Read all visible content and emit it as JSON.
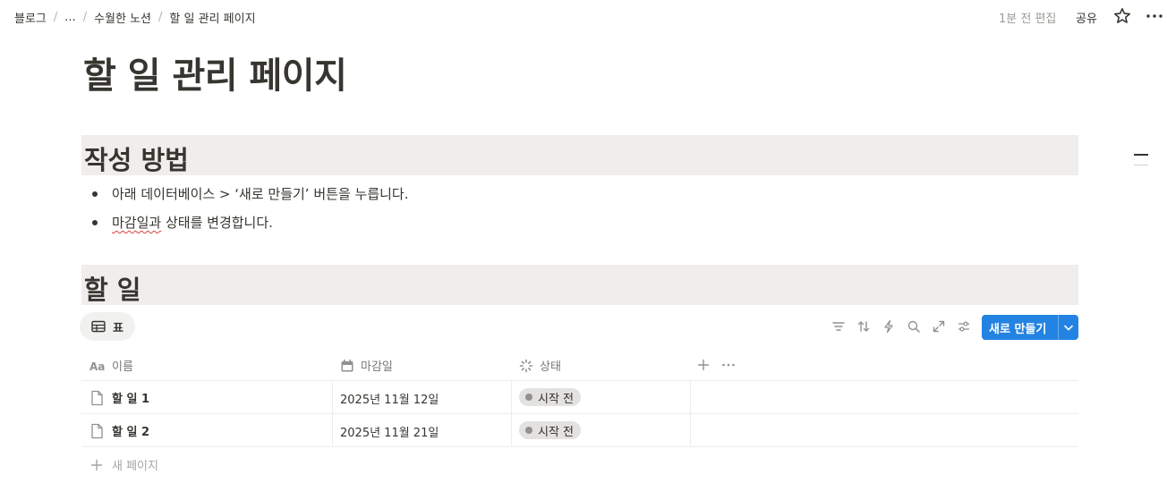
{
  "breadcrumb": [
    "블로그",
    "...",
    "수월한 노션",
    "할 일 관리 페이지"
  ],
  "topbar": {
    "edited": "1분 전 편집",
    "share_label": "공유"
  },
  "page": {
    "title": "할 일 관리 페이지"
  },
  "sections": [
    {
      "heading": "작성 방법",
      "bullets": [
        {
          "text": "아래 데이터베이스 > ‘새로 만들기’ 버튼을 누릅니다."
        },
        {
          "misspelled": "마감일과",
          "rest": " 상태를 변경합니다."
        }
      ]
    },
    {
      "heading": "할 일"
    }
  ],
  "database": {
    "view_label": "표",
    "new_button_label": "새로 만들기",
    "columns": [
      {
        "icon": "text-icon",
        "label": "이름"
      },
      {
        "icon": "calendar-icon",
        "label": "마감일"
      },
      {
        "icon": "status-icon",
        "label": "상태"
      }
    ],
    "rows": [
      {
        "name": "할 일 1",
        "due": "2025년 11월 12일",
        "status": "시작 전"
      },
      {
        "name": "할 일 2",
        "due": "2025년 11월 21일",
        "status": "시작 전"
      }
    ],
    "new_page_label": "새 페이지"
  },
  "colors": {
    "accent": "#2383e2",
    "heading_bg": "#efeeec",
    "status_badge": "#e3e2e0"
  }
}
